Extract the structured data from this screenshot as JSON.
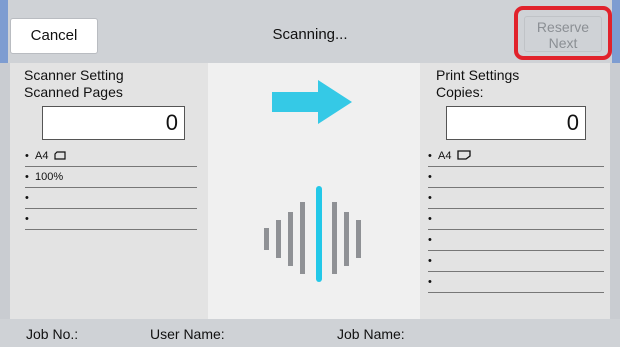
{
  "toolbar": {
    "cancel_label": "Cancel",
    "title": "Scanning...",
    "reserve_next_line1": "Reserve",
    "reserve_next_line2": "Next"
  },
  "scanner": {
    "title_line1": "Scanner Setting",
    "title_line2": "Scanned Pages",
    "count": "0",
    "rows": [
      "A4",
      "100%",
      "",
      ""
    ]
  },
  "print": {
    "title_line1": "Print Settings",
    "title_line2": "Copies:",
    "count": "0",
    "rows": [
      "A4",
      "",
      "",
      "",
      "",
      "",
      ""
    ]
  },
  "status": {
    "job_no_label": "Job No.:",
    "user_name_label": "User Name:",
    "job_name_label": "Job Name:"
  },
  "icons": {
    "arrow": "right-arrow-icon",
    "scan_bars": "scan-progress-icon",
    "paper_portrait": "paper-portrait-icon",
    "paper_landscape": "paper-landscape-icon"
  },
  "colors": {
    "highlight_border": "#e1222b",
    "arrow": "#35c9e6",
    "scan_line": "#23c8e8",
    "bars": "#8f9195"
  }
}
